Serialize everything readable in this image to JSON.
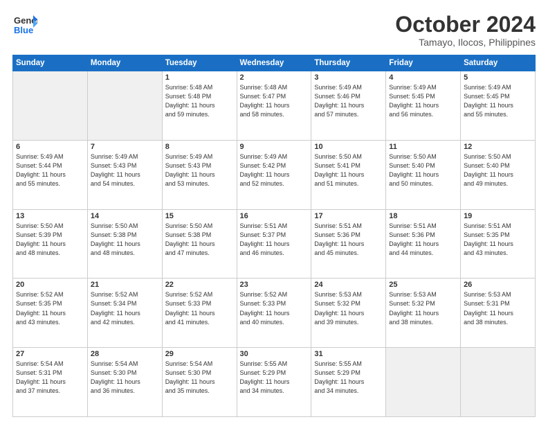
{
  "header": {
    "logo_line1": "General",
    "logo_line2": "Blue",
    "month": "October 2024",
    "location": "Tamayo, Ilocos, Philippines"
  },
  "weekdays": [
    "Sunday",
    "Monday",
    "Tuesday",
    "Wednesday",
    "Thursday",
    "Friday",
    "Saturday"
  ],
  "weeks": [
    [
      {
        "day": "",
        "empty": true
      },
      {
        "day": "",
        "empty": true
      },
      {
        "day": "1",
        "lines": [
          "Sunrise: 5:48 AM",
          "Sunset: 5:48 PM",
          "Daylight: 11 hours",
          "and 59 minutes."
        ]
      },
      {
        "day": "2",
        "lines": [
          "Sunrise: 5:48 AM",
          "Sunset: 5:47 PM",
          "Daylight: 11 hours",
          "and 58 minutes."
        ]
      },
      {
        "day": "3",
        "lines": [
          "Sunrise: 5:49 AM",
          "Sunset: 5:46 PM",
          "Daylight: 11 hours",
          "and 57 minutes."
        ]
      },
      {
        "day": "4",
        "lines": [
          "Sunrise: 5:49 AM",
          "Sunset: 5:45 PM",
          "Daylight: 11 hours",
          "and 56 minutes."
        ]
      },
      {
        "day": "5",
        "lines": [
          "Sunrise: 5:49 AM",
          "Sunset: 5:45 PM",
          "Daylight: 11 hours",
          "and 55 minutes."
        ]
      }
    ],
    [
      {
        "day": "6",
        "lines": [
          "Sunrise: 5:49 AM",
          "Sunset: 5:44 PM",
          "Daylight: 11 hours",
          "and 55 minutes."
        ]
      },
      {
        "day": "7",
        "lines": [
          "Sunrise: 5:49 AM",
          "Sunset: 5:43 PM",
          "Daylight: 11 hours",
          "and 54 minutes."
        ]
      },
      {
        "day": "8",
        "lines": [
          "Sunrise: 5:49 AM",
          "Sunset: 5:43 PM",
          "Daylight: 11 hours",
          "and 53 minutes."
        ]
      },
      {
        "day": "9",
        "lines": [
          "Sunrise: 5:49 AM",
          "Sunset: 5:42 PM",
          "Daylight: 11 hours",
          "and 52 minutes."
        ]
      },
      {
        "day": "10",
        "lines": [
          "Sunrise: 5:50 AM",
          "Sunset: 5:41 PM",
          "Daylight: 11 hours",
          "and 51 minutes."
        ]
      },
      {
        "day": "11",
        "lines": [
          "Sunrise: 5:50 AM",
          "Sunset: 5:40 PM",
          "Daylight: 11 hours",
          "and 50 minutes."
        ]
      },
      {
        "day": "12",
        "lines": [
          "Sunrise: 5:50 AM",
          "Sunset: 5:40 PM",
          "Daylight: 11 hours",
          "and 49 minutes."
        ]
      }
    ],
    [
      {
        "day": "13",
        "lines": [
          "Sunrise: 5:50 AM",
          "Sunset: 5:39 PM",
          "Daylight: 11 hours",
          "and 48 minutes."
        ]
      },
      {
        "day": "14",
        "lines": [
          "Sunrise: 5:50 AM",
          "Sunset: 5:38 PM",
          "Daylight: 11 hours",
          "and 48 minutes."
        ]
      },
      {
        "day": "15",
        "lines": [
          "Sunrise: 5:50 AM",
          "Sunset: 5:38 PM",
          "Daylight: 11 hours",
          "and 47 minutes."
        ]
      },
      {
        "day": "16",
        "lines": [
          "Sunrise: 5:51 AM",
          "Sunset: 5:37 PM",
          "Daylight: 11 hours",
          "and 46 minutes."
        ]
      },
      {
        "day": "17",
        "lines": [
          "Sunrise: 5:51 AM",
          "Sunset: 5:36 PM",
          "Daylight: 11 hours",
          "and 45 minutes."
        ]
      },
      {
        "day": "18",
        "lines": [
          "Sunrise: 5:51 AM",
          "Sunset: 5:36 PM",
          "Daylight: 11 hours",
          "and 44 minutes."
        ]
      },
      {
        "day": "19",
        "lines": [
          "Sunrise: 5:51 AM",
          "Sunset: 5:35 PM",
          "Daylight: 11 hours",
          "and 43 minutes."
        ]
      }
    ],
    [
      {
        "day": "20",
        "lines": [
          "Sunrise: 5:52 AM",
          "Sunset: 5:35 PM",
          "Daylight: 11 hours",
          "and 43 minutes."
        ]
      },
      {
        "day": "21",
        "lines": [
          "Sunrise: 5:52 AM",
          "Sunset: 5:34 PM",
          "Daylight: 11 hours",
          "and 42 minutes."
        ]
      },
      {
        "day": "22",
        "lines": [
          "Sunrise: 5:52 AM",
          "Sunset: 5:33 PM",
          "Daylight: 11 hours",
          "and 41 minutes."
        ]
      },
      {
        "day": "23",
        "lines": [
          "Sunrise: 5:52 AM",
          "Sunset: 5:33 PM",
          "Daylight: 11 hours",
          "and 40 minutes."
        ]
      },
      {
        "day": "24",
        "lines": [
          "Sunrise: 5:53 AM",
          "Sunset: 5:32 PM",
          "Daylight: 11 hours",
          "and 39 minutes."
        ]
      },
      {
        "day": "25",
        "lines": [
          "Sunrise: 5:53 AM",
          "Sunset: 5:32 PM",
          "Daylight: 11 hours",
          "and 38 minutes."
        ]
      },
      {
        "day": "26",
        "lines": [
          "Sunrise: 5:53 AM",
          "Sunset: 5:31 PM",
          "Daylight: 11 hours",
          "and 38 minutes."
        ]
      }
    ],
    [
      {
        "day": "27",
        "lines": [
          "Sunrise: 5:54 AM",
          "Sunset: 5:31 PM",
          "Daylight: 11 hours",
          "and 37 minutes."
        ]
      },
      {
        "day": "28",
        "lines": [
          "Sunrise: 5:54 AM",
          "Sunset: 5:30 PM",
          "Daylight: 11 hours",
          "and 36 minutes."
        ]
      },
      {
        "day": "29",
        "lines": [
          "Sunrise: 5:54 AM",
          "Sunset: 5:30 PM",
          "Daylight: 11 hours",
          "and 35 minutes."
        ]
      },
      {
        "day": "30",
        "lines": [
          "Sunrise: 5:55 AM",
          "Sunset: 5:29 PM",
          "Daylight: 11 hours",
          "and 34 minutes."
        ]
      },
      {
        "day": "31",
        "lines": [
          "Sunrise: 5:55 AM",
          "Sunset: 5:29 PM",
          "Daylight: 11 hours",
          "and 34 minutes."
        ]
      },
      {
        "day": "",
        "empty": true
      },
      {
        "day": "",
        "empty": true
      }
    ]
  ]
}
